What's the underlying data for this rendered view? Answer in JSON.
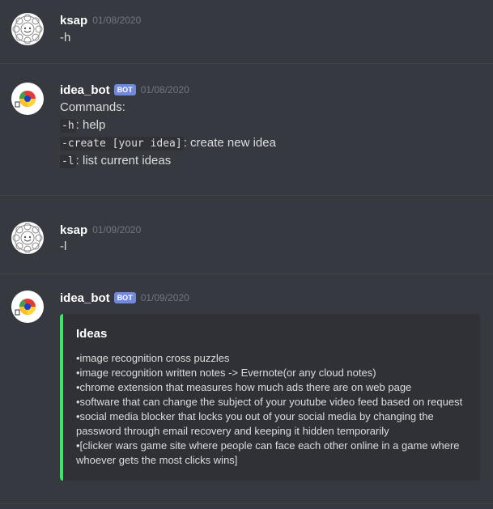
{
  "messages": [
    {
      "username": "ksap",
      "timestamp": "01/08/2020",
      "text": "-h"
    },
    {
      "username": "idea_bot",
      "bot_tag": "BOT",
      "timestamp": "01/08/2020",
      "title": "Commands:",
      "commands": [
        {
          "code": "-h",
          "desc": ": help"
        },
        {
          "code": "-create [your idea]",
          "desc": ": create new idea"
        },
        {
          "code": "-l",
          "desc": ": list current ideas"
        }
      ]
    },
    {
      "username": "ksap",
      "timestamp": "01/09/2020",
      "text": "-l"
    },
    {
      "username": "idea_bot",
      "bot_tag": "BOT",
      "timestamp": "01/09/2020",
      "embed": {
        "title": "Ideas",
        "accent_color": "#43e36b",
        "lines": [
          "•image recognition cross puzzles",
          "•image recognition written notes -> Evernote(or any cloud notes)",
          "•chrome extension that measures how much ads there are on web page",
          "•software that can change the subject of your youtube video feed based on request",
          "•social media blocker that locks you out of your social media by changing the password through email recovery and keeping it hidden temporarily",
          "•[clicker wars game site where people can face each other online in a game where whoever gets the most clicks wins]"
        ]
      }
    }
  ],
  "colors": {
    "background": "#36393f",
    "bot_tag": "#7289da",
    "embed_background": "#2f3136"
  }
}
